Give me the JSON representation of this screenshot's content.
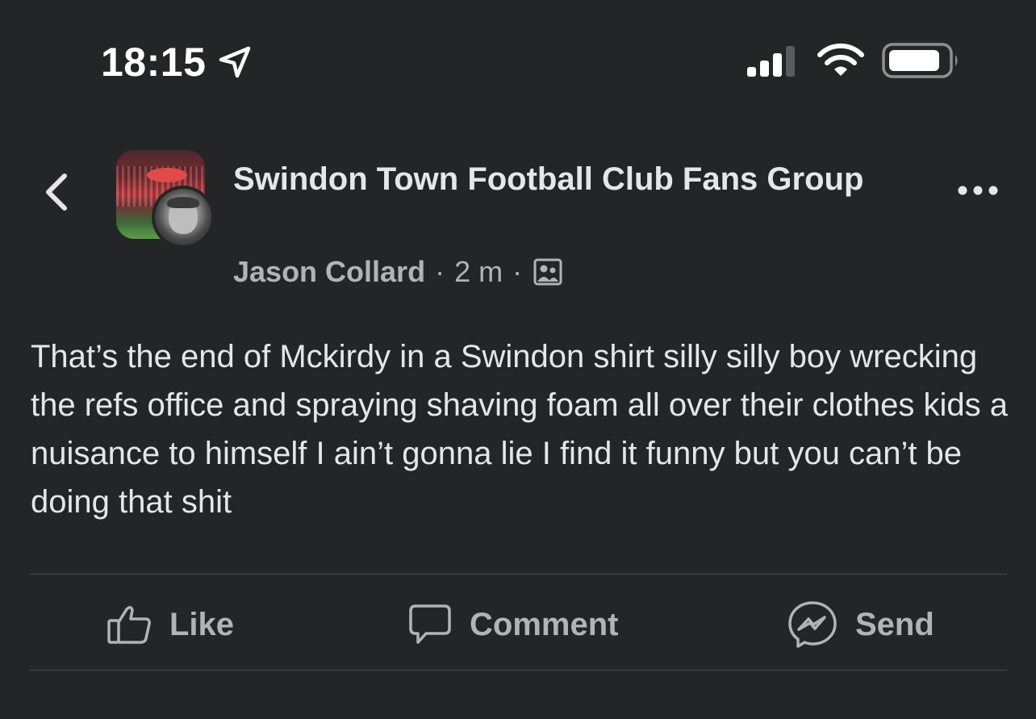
{
  "status_bar": {
    "time": "18:15",
    "icons": [
      "location-arrow-icon",
      "cellular-signal-icon",
      "wifi-icon",
      "battery-icon"
    ]
  },
  "post": {
    "group_name": "Swindon Town Football Club Fans Group",
    "author": "Jason Collard",
    "separator": "·",
    "time_ago": "2 m",
    "audience_icon": "members-only-icon",
    "text": "That’s the end of Mckirdy in a Swindon shirt silly silly boy wrecking the refs office and spraying shaving foam all over their clothes kids a nuisance to himself I ain’t gonna lie I find it funny but you can’t be doing that shit"
  },
  "actions": {
    "like_label": "Like",
    "comment_label": "Comment",
    "send_label": "Send"
  },
  "colors": {
    "background": "#242526",
    "primary_text": "#e4e6eb",
    "secondary_text": "#b0b3b8",
    "divider": "#4a4b4d"
  }
}
